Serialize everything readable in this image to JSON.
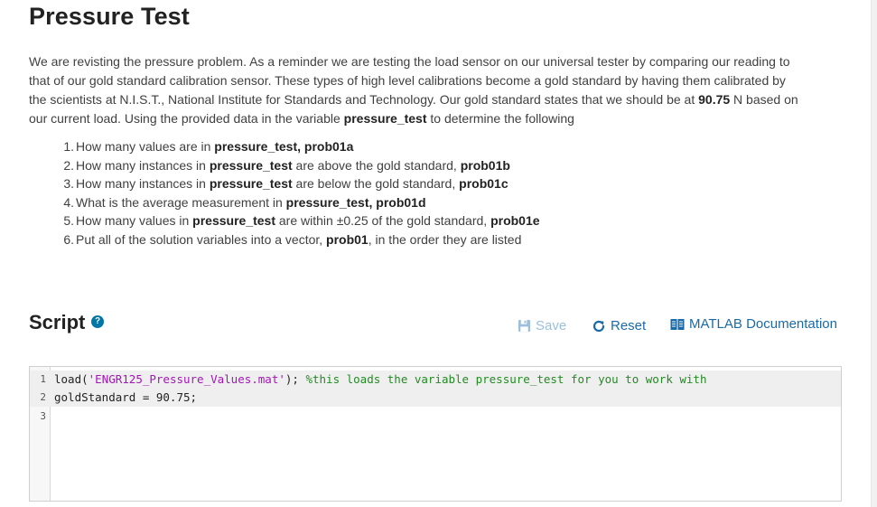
{
  "problem": {
    "title": "Pressure Test",
    "description": {
      "p1": "We are revisting the pressure problem. As a reminder we are testing the load sensor on our universal tester by comparing our reading to that of our gold standard calibration sensor. These types of high level calibrations become a gold standard by having them calibrated by the scientists at N.I.S.T., National Institute for Standards and Technology. Our gold standard states that we should be at ",
      "gold_value": "90.75",
      "p2": " N based on our current load. Using the provided data in the variable ",
      "var_name": "pressure_test",
      "p3": " to determine the following"
    },
    "questions": [
      {
        "num": "1.",
        "a": "How many values are in ",
        "b": "pressure_test, prob01a",
        "c": "",
        "d": ""
      },
      {
        "num": "2.",
        "a": "How many instances in ",
        "b": "pressure_test",
        "c": " are above the gold standard, ",
        "d": "prob01b"
      },
      {
        "num": "3.",
        "a": "How many instances in ",
        "b": "pressure_test",
        "c": " are below the gold standard, ",
        "d": "prob01c"
      },
      {
        "num": "4.",
        "a": "What is the average measurement in ",
        "b": "pressure_test, prob01d",
        "c": "",
        "d": ""
      },
      {
        "num": "5.",
        "a": "How many values in ",
        "b": "pressure_test",
        "c": " are within ±0.25 of the gold standard, ",
        "d": "prob01e"
      },
      {
        "num": "6.",
        "a": "Put all of the solution variables into a vector, ",
        "b": "prob01",
        "c": ", in the order they are listed",
        "d": ""
      }
    ]
  },
  "script": {
    "title": "Script",
    "help_glyph": "?",
    "save_label": "Save",
    "reset_label": "Reset",
    "doc_label": "MATLAB Documentation"
  },
  "editor": {
    "lines": [
      {
        "num": "1",
        "fn": "load(",
        "str": "'ENGR125_Pressure_Values.mat'",
        "rest": "); ",
        "comment": "%this loads the variable pressure_test for you to work with"
      },
      {
        "num": "2",
        "fn": "goldStandard = 90.75;",
        "str": "",
        "rest": "",
        "comment": ""
      },
      {
        "num": "3",
        "fn": "",
        "str": "",
        "rest": "",
        "comment": ""
      }
    ]
  },
  "colors": {
    "link": "#1a6aa8",
    "disabled": "#9cc0dc",
    "string": "#a316b8",
    "comment": "#228b22",
    "help": "#0076a8"
  },
  "icons": {
    "save": "floppy-disk-icon",
    "reset": "refresh-icon",
    "doc": "book-icon",
    "help": "question-icon"
  }
}
